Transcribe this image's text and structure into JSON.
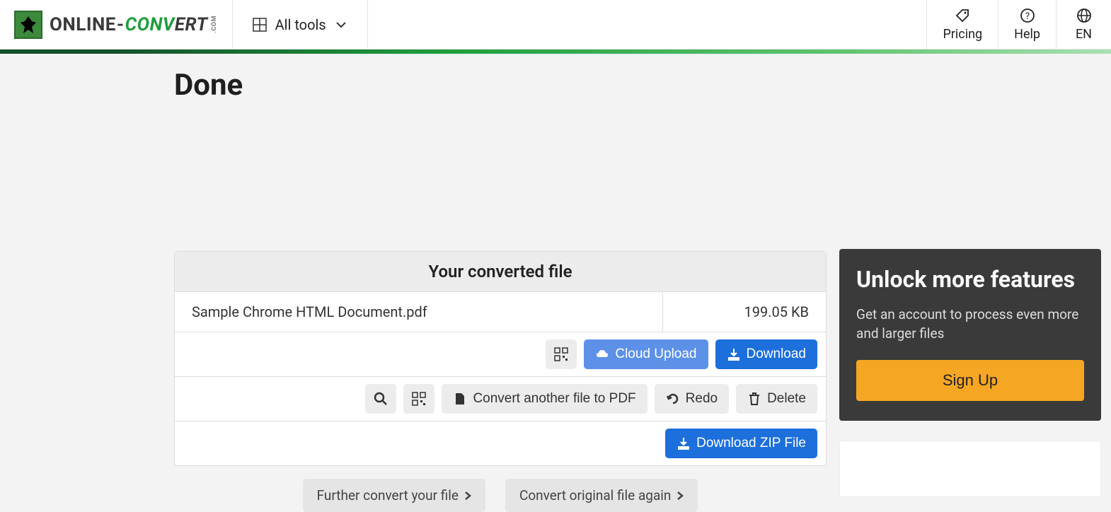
{
  "header": {
    "logo_online": "ONLINE",
    "logo_dash": "-",
    "logo_con": "CON",
    "logo_v": "V",
    "logo_ert": "ERT",
    "logo_com": ".COM",
    "all_tools": "All tools",
    "pricing": "Pricing",
    "help": "Help",
    "lang": "EN"
  },
  "page": {
    "title": "Done",
    "panel_header": "Your converted file",
    "file_name": "Sample Chrome HTML Document.pdf",
    "file_size": "199.05 KB"
  },
  "buttons": {
    "cloud_upload": "Cloud Upload",
    "download": "Download",
    "convert_another": "Convert another file to PDF",
    "redo": "Redo",
    "delete": "Delete",
    "download_zip": "Download ZIP File",
    "further_convert": "Further convert your file",
    "convert_again": "Convert original file again"
  },
  "promo": {
    "title": "Unlock more features",
    "body": "Get an account to process even more and larger files",
    "sign_up": "Sign Up"
  }
}
